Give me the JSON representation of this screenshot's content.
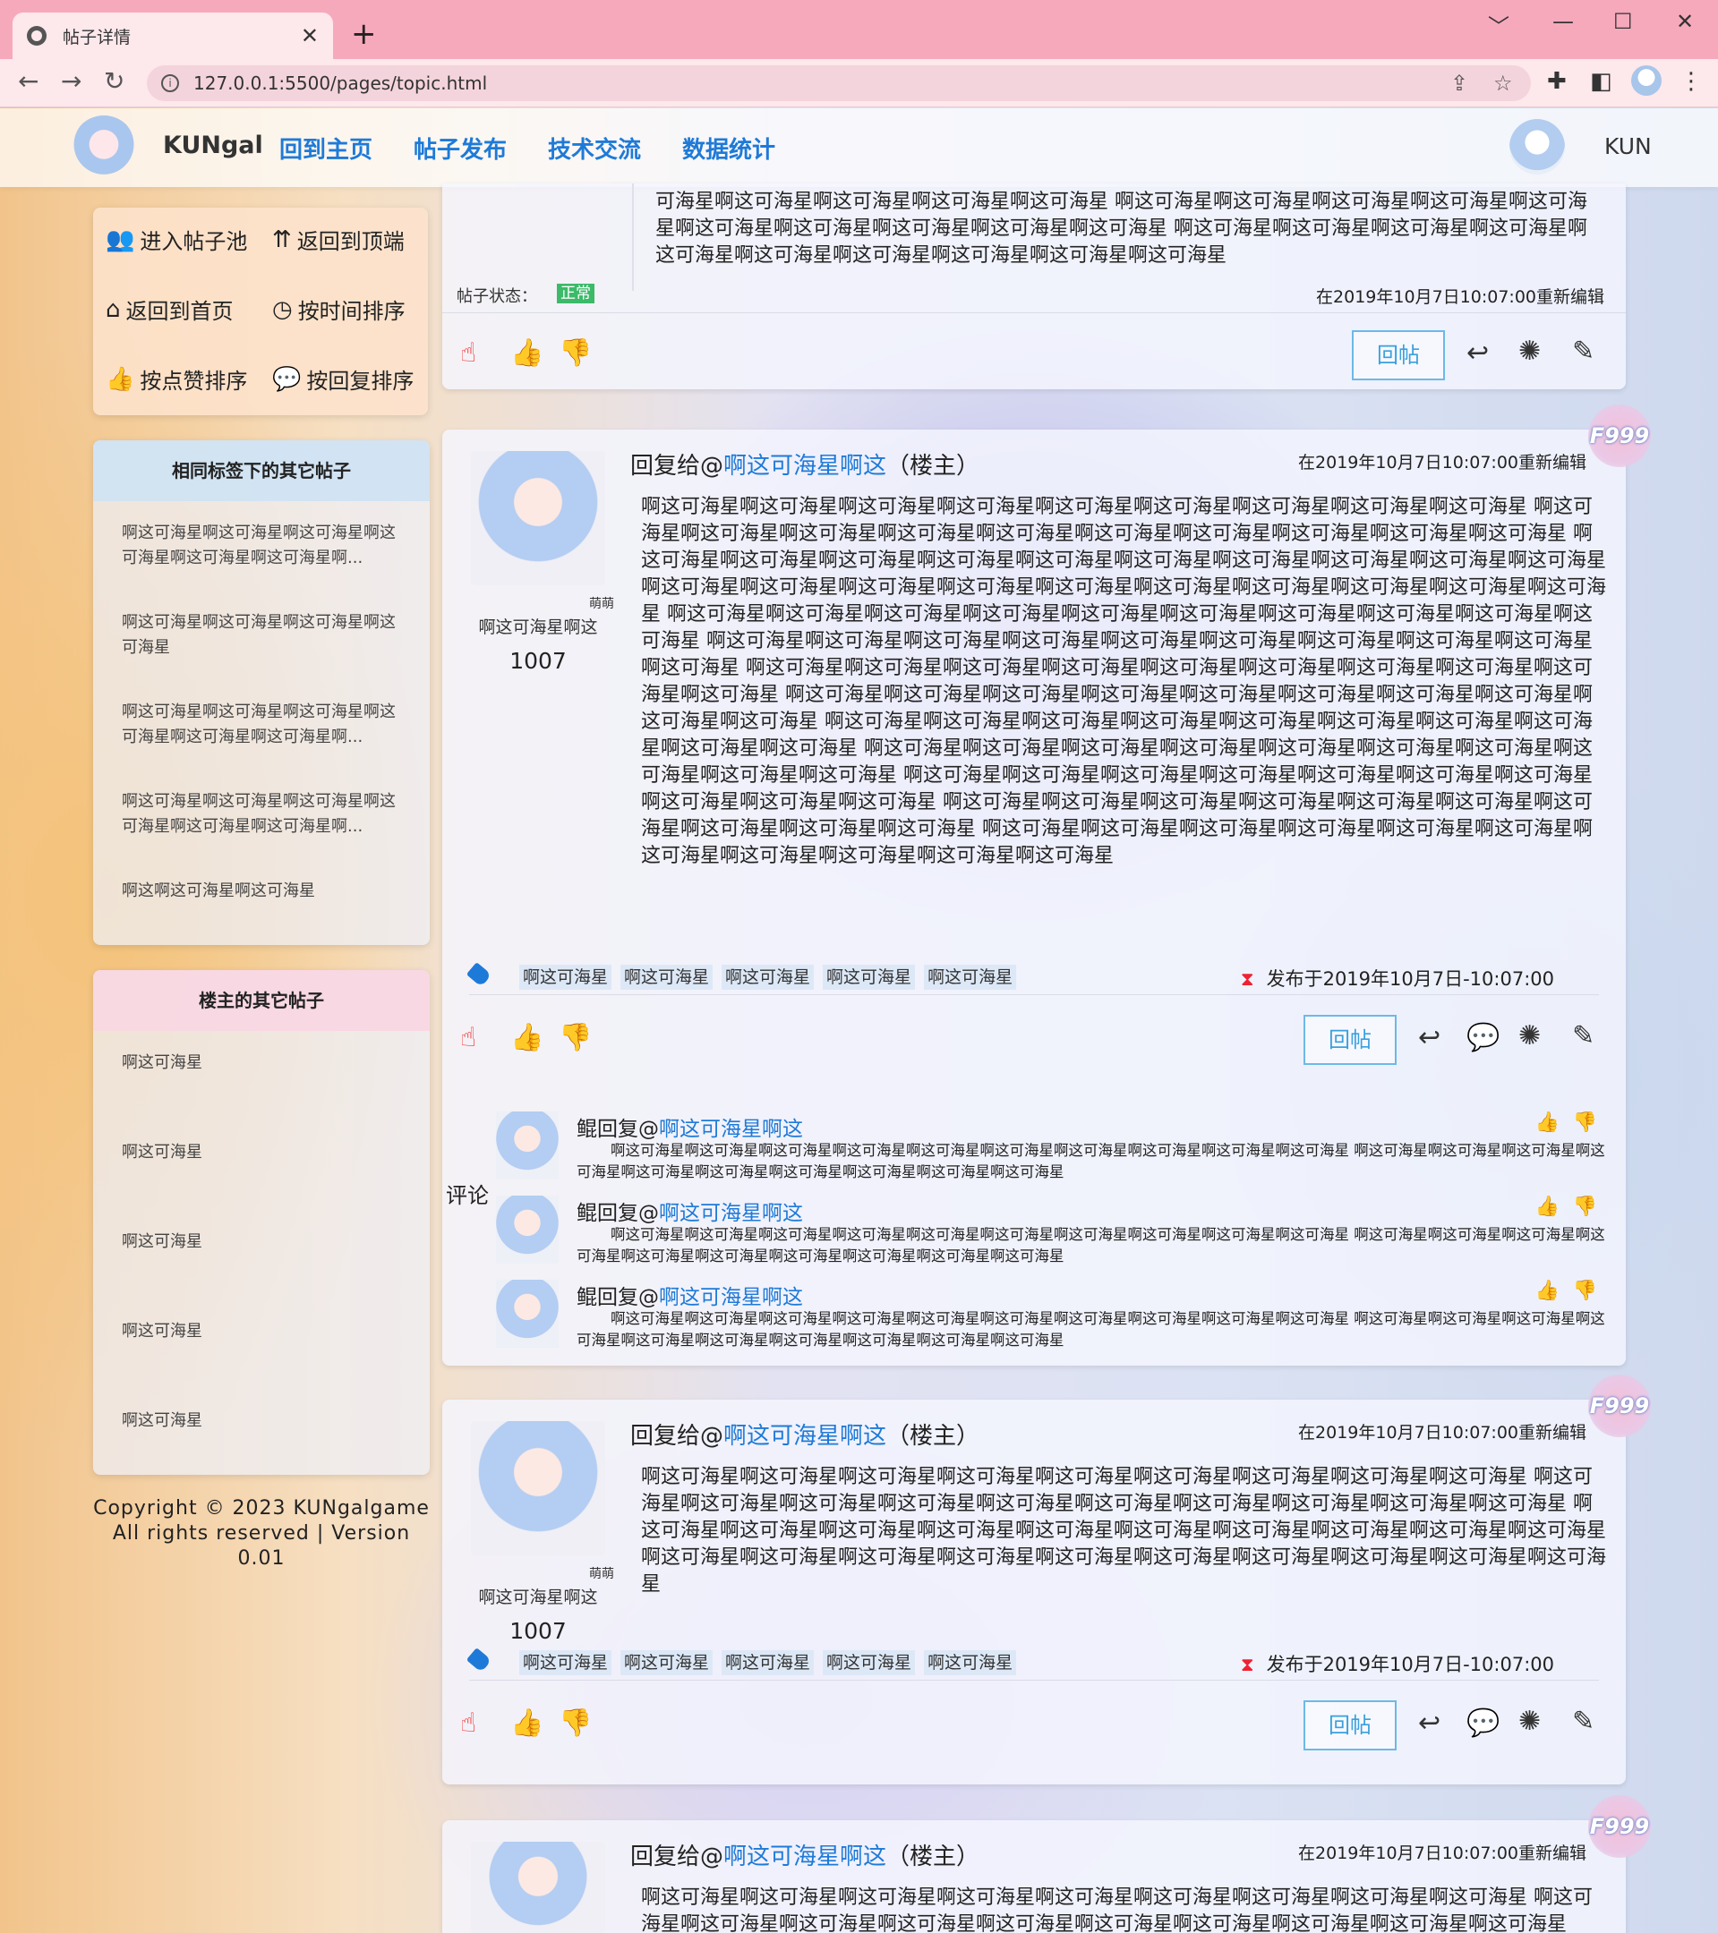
{
  "browser": {
    "tab_title": "帖子详情",
    "new_tab": "+",
    "url": "127.0.0.1:5500/pages/topic.html",
    "win_controls": [
      "﹀",
      "—",
      "☐",
      "✕"
    ]
  },
  "header": {
    "brand": "KUNgal",
    "menu": [
      "回到主页",
      "帖子发布",
      "技术交流",
      "数据统计"
    ],
    "username": "KUN"
  },
  "sidebar": {
    "nav": [
      {
        "icon": "group-icon",
        "label": "进入帖子池"
      },
      {
        "icon": "to-top-icon",
        "label": "返回到顶端"
      },
      {
        "icon": "home-icon",
        "label": "返回到首页"
      },
      {
        "icon": "clock-icon",
        "label": "按时间排序"
      },
      {
        "icon": "thumbs-up-icon",
        "label": "按点赞排序"
      },
      {
        "icon": "comment-icon",
        "label": "按回复排序"
      }
    ],
    "same_tag": {
      "title": "相同标签下的其它帖子",
      "items": [
        "啊这可海星啊这可海星啊这可海星啊这可海星啊这可海星啊这可海星啊...",
        "啊这可海星啊这可海星啊这可海星啊这可海星",
        "啊这可海星啊这可海星啊这可海星啊这可海星啊这可海星啊这可海星啊...",
        "啊这可海星啊这可海星啊这可海星啊这可海星啊这可海星啊这可海星啊...",
        "啊这啊这可海星啊这可海星"
      ]
    },
    "owner_posts": {
      "title": "楼主的其它帖子",
      "items": [
        "啊这可海星",
        "啊这可海星",
        "啊这可海星",
        "啊这可海星",
        "啊这可海星"
      ]
    },
    "copyright": [
      "Copyright © 2023 KUNgalgame",
      "All rights reserved | Version 0.01"
    ]
  },
  "top_post": {
    "body": "可海星啊这可海星啊这可海星啊这可海星啊这可海星 啊这可海星啊这可海星啊这可海星啊这可海星啊这可海星啊这可海星啊这可海星啊这可海星啊这可海星啊这可海星 啊这可海星啊这可海星啊这可海星啊这可海星啊这可海星啊这可海星啊这可海星啊这可海星啊这可海星啊这可海星",
    "status_label": "帖子状态：",
    "status_value": "正常",
    "edited": "在2019年10月7日10:07:00重新编辑",
    "reply_button": "回帖"
  },
  "post_common": {
    "reply_prefix": "回复给@",
    "reply_target": "啊这可海星啊这",
    "reply_suffix": "（楼主）",
    "edited": "在2019年10月7日10:07:00重新编辑",
    "badge": "萌萌",
    "author": "啊这可海星啊这",
    "author_num": "1007",
    "tags": [
      "啊这可海星",
      "啊这可海星",
      "啊这可海星",
      "啊这可海星",
      "啊这可海星"
    ],
    "published": "发布于2019年10月7日-10:07:00",
    "reply_button": "回帖",
    "floor": "F999"
  },
  "post1": {
    "body": "啊这可海星啊这可海星啊这可海星啊这可海星啊这可海星啊这可海星啊这可海星啊这可海星啊这可海星 啊这可海星啊这可海星啊这可海星啊这可海星啊这可海星啊这可海星啊这可海星啊这可海星啊这可海星啊这可海星 啊这可海星啊这可海星啊这可海星啊这可海星啊这可海星啊这可海星啊这可海星啊这可海星啊这可海星啊这可海星 啊这可海星啊这可海星啊这可海星啊这可海星啊这可海星啊这可海星啊这可海星啊这可海星啊这可海星啊这可海星 啊这可海星啊这可海星啊这可海星啊这可海星啊这可海星啊这可海星啊这可海星啊这可海星啊这可海星啊这可海星 啊这可海星啊这可海星啊这可海星啊这可海星啊这可海星啊这可海星啊这可海星啊这可海星啊这可海星啊这可海星 啊这可海星啊这可海星啊这可海星啊这可海星啊这可海星啊这可海星啊这可海星啊这可海星啊这可海星啊这可海星 啊这可海星啊这可海星啊这可海星啊这可海星啊这可海星啊这可海星啊这可海星啊这可海星啊这可海星啊这可海星 啊这可海星啊这可海星啊这可海星啊这可海星啊这可海星啊这可海星啊这可海星啊这可海星啊这可海星啊这可海星 啊这可海星啊这可海星啊这可海星啊这可海星啊这可海星啊这可海星啊这可海星啊这可海星啊这可海星啊这可海星 啊这可海星啊这可海星啊这可海星啊这可海星啊这可海星啊这可海星啊这可海星啊这可海星啊这可海星啊这可海星 啊这可海星啊这可海星啊这可海星啊这可海星啊这可海星啊这可海星啊这可海星啊这可海星啊这可海星啊这可海星 啊这可海星啊这可海星啊这可海星啊这可海星啊这可海星啊这可海星啊这可海星啊这可海星啊这可海星啊这可海星啊这可海星",
    "comment_label": "评论",
    "comments": [
      {
        "who": "鲲回复@",
        "target": "啊这可海星啊这",
        "text": "啊这可海星啊这可海星啊这可海星啊这可海星啊这可海星啊这可海星啊这可海星啊这可海星啊这可海星啊这可海星 啊这可海星啊这可海星啊这可海星啊这可海星啊这可海星啊这可海星啊这可海星啊这可海星啊这可海星啊这可海星"
      },
      {
        "who": "鲲回复@",
        "target": "啊这可海星啊这",
        "text": "啊这可海星啊这可海星啊这可海星啊这可海星啊这可海星啊这可海星啊这可海星啊这可海星啊这可海星啊这可海星 啊这可海星啊这可海星啊这可海星啊这可海星啊这可海星啊这可海星啊这可海星啊这可海星啊这可海星啊这可海星"
      },
      {
        "who": "鲲回复@",
        "target": "啊这可海星啊这",
        "text": "啊这可海星啊这可海星啊这可海星啊这可海星啊这可海星啊这可海星啊这可海星啊这可海星啊这可海星啊这可海星 啊这可海星啊这可海星啊这可海星啊这可海星啊这可海星啊这可海星啊这可海星啊这可海星啊这可海星啊这可海星"
      }
    ]
  },
  "post2": {
    "body": "啊这可海星啊这可海星啊这可海星啊这可海星啊这可海星啊这可海星啊这可海星啊这可海星啊这可海星 啊这可海星啊这可海星啊这可海星啊这可海星啊这可海星啊这可海星啊这可海星啊这可海星啊这可海星啊这可海星 啊这可海星啊这可海星啊这可海星啊这可海星啊这可海星啊这可海星啊这可海星啊这可海星啊这可海星啊这可海星 啊这可海星啊这可海星啊这可海星啊这可海星啊这可海星啊这可海星啊这可海星啊这可海星啊这可海星啊这可海星"
  },
  "post3": {
    "body": "啊这可海星啊这可海星啊这可海星啊这可海星啊这可海星啊这可海星啊这可海星啊这可海星啊这可海星 啊这可海星啊这可海星啊这可海星啊这可海星啊这可海星啊这可海星啊这可海星啊这可海星啊这可海星啊这可海星"
  },
  "colors": {
    "accent": "#1e7ad8",
    "status_ok": "#3cba6a",
    "tab_bar": "#f7a9bc",
    "reply_border": "#6cb9e6"
  }
}
